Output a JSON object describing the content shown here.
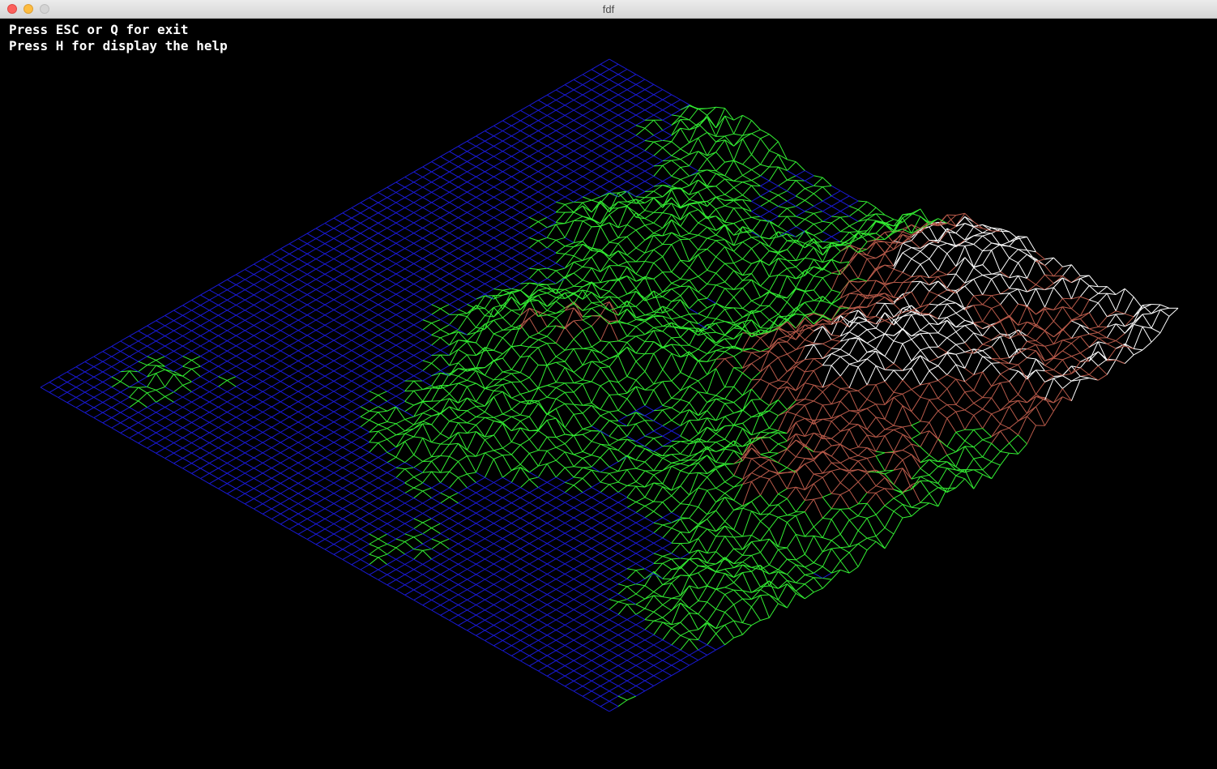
{
  "window": {
    "title": "fdf"
  },
  "hud": {
    "line1": "Press ESC or Q for exit",
    "line2": "Press H for display the help"
  },
  "palette": {
    "water": "#1a1ad8",
    "land": "#33ee33",
    "mountain": "#b85a4a",
    "peak": "#ffffff",
    "background": "#000000"
  }
}
